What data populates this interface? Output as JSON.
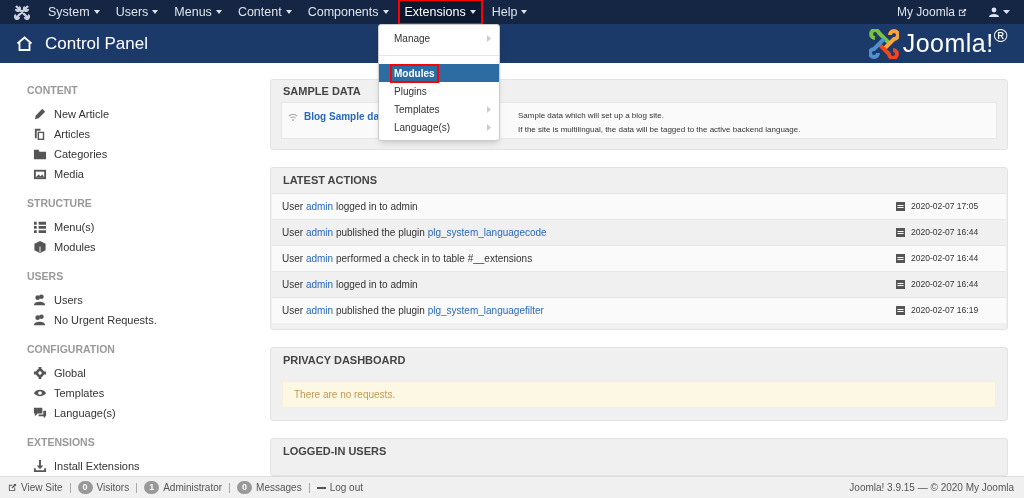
{
  "top_menu": [
    {
      "label": "System",
      "selected": false,
      "annotated": false
    },
    {
      "label": "Users",
      "selected": false,
      "annotated": false
    },
    {
      "label": "Menus",
      "selected": false,
      "annotated": false
    },
    {
      "label": "Content",
      "selected": false,
      "annotated": false
    },
    {
      "label": "Components",
      "selected": false,
      "annotated": false
    },
    {
      "label": "Extensions",
      "selected": true,
      "annotated": true
    },
    {
      "label": "Help",
      "selected": false,
      "annotated": false
    }
  ],
  "top_right": {
    "site_link": "My Joomla"
  },
  "dropdown": [
    {
      "kind": "item",
      "label": "Manage",
      "submenu": true,
      "selected": false,
      "annotated": false
    },
    {
      "kind": "divider"
    },
    {
      "kind": "item",
      "label": "Modules",
      "submenu": false,
      "selected": true,
      "annotated": true
    },
    {
      "kind": "item",
      "label": "Plugins",
      "submenu": false,
      "selected": false,
      "annotated": false
    },
    {
      "kind": "item",
      "label": "Templates",
      "submenu": true,
      "selected": false,
      "annotated": false
    },
    {
      "kind": "item",
      "label": "Language(s)",
      "submenu": true,
      "selected": false,
      "annotated": false
    }
  ],
  "header": {
    "title": "Control Panel",
    "logo_text": "Joomla!$^{®}$"
  },
  "sidebar": [
    {
      "heading": "CONTENT",
      "items": [
        {
          "label": "New Article"
        },
        {
          "label": "Articles"
        },
        {
          "label": "Categories"
        },
        {
          "label": "Media"
        }
      ]
    },
    {
      "heading": "STRUCTURE",
      "items": [
        {
          "label": "Menu(s)"
        },
        {
          "label": "Modules"
        }
      ]
    },
    {
      "heading": "USERS",
      "items": [
        {
          "label": "Users"
        },
        {
          "label": "No Urgent Requests."
        }
      ]
    },
    {
      "heading": "CONFIGURATION",
      "items": [
        {
          "label": "Global"
        },
        {
          "label": "Templates"
        },
        {
          "label": "Language(s)"
        }
      ]
    },
    {
      "heading": "EXTENSIONS",
      "items": [
        {
          "label": "Install Extensions"
        }
      ]
    }
  ],
  "sample_data": {
    "title": "SAMPLE DATA",
    "item": "Blog Sample da",
    "description": [
      "Sample data which will set up a blog site.",
      "If the site is multilingual, the data will be tagged to the active backend language."
    ]
  },
  "latest_actions": {
    "title": "LATEST ACTIONS",
    "rows": [
      {
        "parts": [
          {
            "text": "User ",
            "link": false
          },
          {
            "text": "admin",
            "link": true
          },
          {
            "text": " logged in to admin",
            "link": false
          }
        ],
        "date": "2020-02-07 17:05"
      },
      {
        "parts": [
          {
            "text": "User ",
            "link": false
          },
          {
            "text": "admin",
            "link": true
          },
          {
            "text": " published the plugin ",
            "link": false
          },
          {
            "text": "plg_system_languagecode",
            "link": true
          }
        ],
        "date": "2020-02-07 16:44"
      },
      {
        "parts": [
          {
            "text": "User ",
            "link": false
          },
          {
            "text": "admin",
            "link": true
          },
          {
            "text": " performed a check in to table #__extensions",
            "link": false
          }
        ],
        "date": "2020-02-07 16:44"
      },
      {
        "parts": [
          {
            "text": "User ",
            "link": false
          },
          {
            "text": "admin",
            "link": true
          },
          {
            "text": " logged in to admin",
            "link": false
          }
        ],
        "date": "2020-02-07 16:44"
      },
      {
        "parts": [
          {
            "text": "User ",
            "link": false
          },
          {
            "text": "admin",
            "link": true
          },
          {
            "text": " published the plugin ",
            "link": false
          },
          {
            "text": "plg_system_languagefilter",
            "link": true
          }
        ],
        "date": "2020-02-07 16:19"
      }
    ]
  },
  "privacy_dashboard": {
    "title": "PRIVACY DASHBOARD",
    "notice": "There are no requests."
  },
  "logged_in_users": {
    "title": "LOGGED-IN USERS"
  },
  "status_bar": {
    "view_site": "View Site",
    "badges": [
      {
        "count": "0",
        "label": "Visitors"
      },
      {
        "count": "1",
        "label": "Administrator"
      },
      {
        "count": "0",
        "label": "Messages"
      }
    ],
    "logout": "Log out",
    "footer": "Joomla! 3.9.15 — © 2020 My Joomla"
  }
}
